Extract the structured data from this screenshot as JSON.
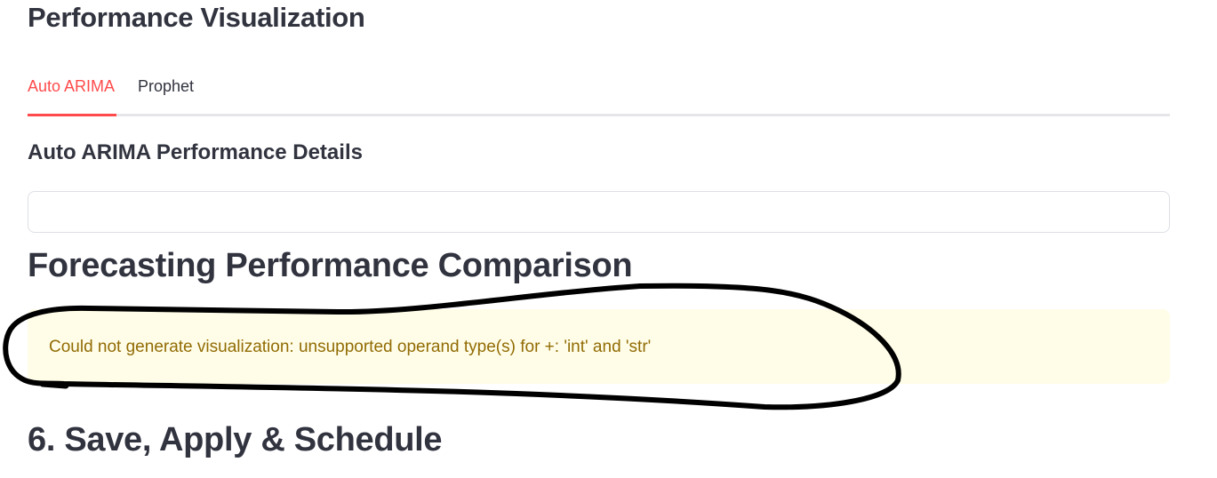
{
  "section": {
    "title": "Performance Visualization"
  },
  "tabs": [
    {
      "label": "Auto ARIMA",
      "active": true
    },
    {
      "label": "Prophet",
      "active": false
    }
  ],
  "details": {
    "title": "Auto ARIMA Performance Details"
  },
  "comparison": {
    "title": "Forecasting Performance Comparison",
    "warning": "Could not generate visualization: unsupported operand type(s) for +: 'int' and 'str'"
  },
  "next_section": {
    "title": "6. Save, Apply & Schedule"
  },
  "colors": {
    "accent": "#ff4b4b",
    "warning_bg": "#fffde7",
    "warning_text": "#926c05",
    "text": "#31333f"
  }
}
